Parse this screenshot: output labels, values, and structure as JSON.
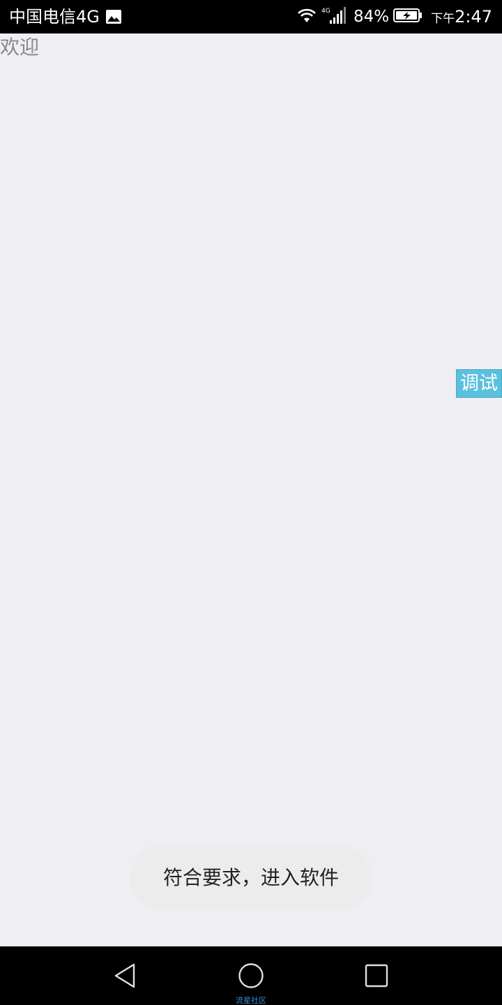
{
  "status_bar": {
    "carrier": "中国电信4G",
    "network_type": "4G",
    "battery_percent": "84%",
    "ampm": "下午",
    "time": "2:47",
    "icons": [
      "image-icon",
      "wifi-icon",
      "signal-icon",
      "battery-charging-icon"
    ]
  },
  "content": {
    "welcome_text": "欢迎",
    "debug_label": "调试",
    "toast_message": "符合要求，进入软件"
  },
  "nav_bar": {
    "icons": [
      "back-icon",
      "home-icon",
      "recent-apps-icon"
    ],
    "watermark": "流星社区"
  },
  "colors": {
    "background": "#efeff3",
    "status_bar": "#000000",
    "debug_tab": "#5bc0de",
    "toast_bg": "#ececec",
    "watermark": "#3a8fd6"
  }
}
